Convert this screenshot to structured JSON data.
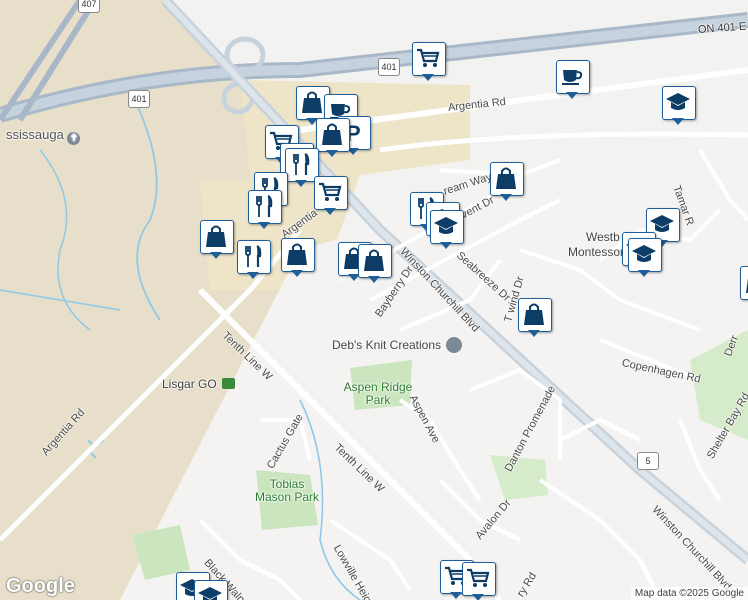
{
  "map": {
    "roads": [
      {
        "id": "winston-churchill-blvd-label-1",
        "text": "Winston Churchill Blvd"
      },
      {
        "id": "winston-churchill-blvd-label-2",
        "text": "Winston Churchill Blvd"
      },
      {
        "id": "argentia-rd-label-1",
        "text": "Argentia Rd"
      },
      {
        "id": "argentia-rd-label-2",
        "text": "Argentia Rd"
      },
      {
        "id": "argentia-rd-label-3",
        "text": "Argentia"
      },
      {
        "id": "tenth-line-w-label-1",
        "text": "Tenth Line W"
      },
      {
        "id": "tenth-line-w-label-2",
        "text": "Tenth Line W"
      },
      {
        "id": "bayberry-dr-label",
        "text": "Bayberry Dr"
      },
      {
        "id": "aspen-ave-label",
        "text": "Aspen Ave"
      },
      {
        "id": "danton-promenade-label",
        "text": "Danton Promenade"
      },
      {
        "id": "avalon-dr-label",
        "text": "Avalon Dr"
      },
      {
        "id": "copenhagen-rd-label",
        "text": "Copenhagen Rd"
      },
      {
        "id": "shelter-bay-rd-label",
        "text": "Shelter Bay Rd"
      },
      {
        "id": "seabreeze-dr-label",
        "text": "Seabreeze Dr"
      },
      {
        "id": "cactus-gate-label",
        "text": "Cactus Gate"
      },
      {
        "id": "lowville-heights-label",
        "text": "Lowville Heights"
      },
      {
        "id": "black-walnut-label",
        "text": "Black Walnut T"
      },
      {
        "id": "tamar-label",
        "text": "Tamar R"
      },
      {
        "id": "dream-way-label",
        "text": "ream Way"
      },
      {
        "id": "vent-dr-label",
        "text": "vent Dr"
      },
      {
        "id": "wind-dr-label",
        "text": "T      wind Dr"
      },
      {
        "id": "ry-rd-label",
        "text": "ry Rd"
      },
      {
        "id": "derr-label",
        "text": "Derr"
      }
    ],
    "highways": [
      {
        "id": "on-401-label",
        "text": "ON 401 E"
      },
      {
        "id": "shield-401-a",
        "text": "401"
      },
      {
        "id": "shield-401-b",
        "text": "401"
      },
      {
        "id": "shield-407",
        "text": "407"
      },
      {
        "id": "shield-5",
        "text": "5"
      }
    ],
    "places": {
      "mississauga": "ssissauga",
      "debs_knit": "Deb's Knit Creations",
      "aspen_ridge": "Aspen Ridge Park",
      "tobias_mason": "Tobias Mason Park",
      "lisgar_go": "Lisgar GO",
      "westb": "Westb",
      "montessori": "Montessori Acad"
    },
    "markers": [
      {
        "icon": "shopping-cart-icon",
        "kind": "shopping-cart"
      },
      {
        "icon": "shopping-bag-icon",
        "kind": "bag"
      },
      {
        "icon": "coffee-cup-icon",
        "kind": "cup"
      },
      {
        "icon": "graduation-cap-icon",
        "kind": "school"
      },
      {
        "icon": "parking-icon",
        "kind": "parking"
      },
      {
        "icon": "restaurant-icon",
        "kind": "food"
      },
      {
        "icon": "hotel-icon",
        "kind": "bed"
      }
    ],
    "footer": {
      "logo": "Google",
      "attribution": "Map data ©2025 Google"
    },
    "colors": {
      "road": "#ffffff",
      "major_road": "#c8d2dc",
      "highway": "#a9b8c8",
      "park": "#cbe6bf",
      "commercial": "#ece4cc",
      "rural": "#e5dcc6",
      "water": "#8ec9e8",
      "marker_border": "#1f5f99",
      "marker_icon": "#0d3c66"
    }
  }
}
